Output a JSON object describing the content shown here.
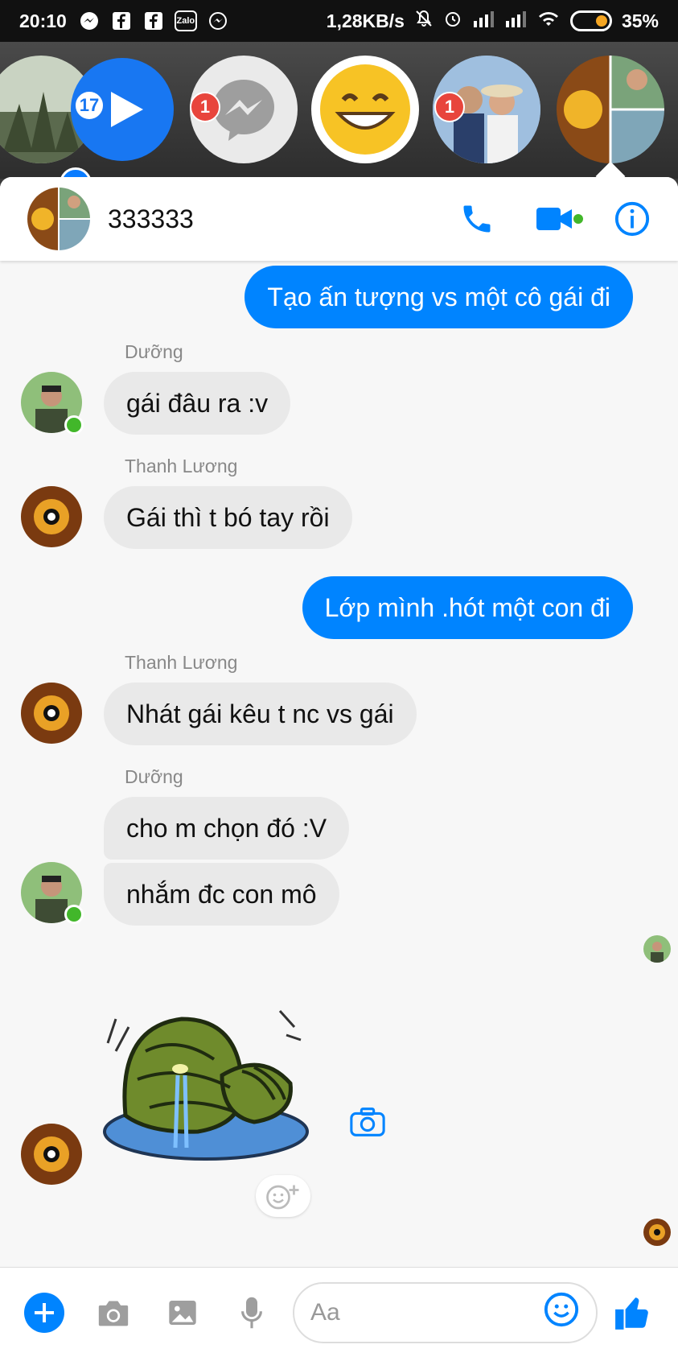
{
  "status_bar": {
    "time": "20:10",
    "icons": [
      "messenger-icon",
      "facebook-icon",
      "facebook-icon",
      "zalo-icon",
      "messenger-icon"
    ],
    "zalo_label": "Zalo",
    "net_speed": "1,28KB/s",
    "battery": "35%"
  },
  "chat_heads": {
    "items": [
      {
        "name": "photo-head"
      },
      {
        "name": "video-head",
        "badge": "17"
      },
      {
        "name": "messenger-head",
        "badge": "1"
      },
      {
        "name": "emoji-head"
      },
      {
        "name": "couple-head",
        "badge": "1"
      },
      {
        "name": "group-head"
      }
    ],
    "zalo_badge": "Zalo"
  },
  "chat": {
    "title": "333333",
    "colors": {
      "accent": "#0084ff",
      "online": "#42b72a"
    },
    "messages": [
      {
        "from": "me",
        "text": "Tạo ấn tượng vs một cô gái đi"
      },
      {
        "sender": "Dưỡng",
        "text": "gái đâu ra :v"
      },
      {
        "sender": "Thanh Lương",
        "text": "Gái thì t bó tay rồi"
      },
      {
        "from": "me",
        "text": "Lớp mình .hót một con đi"
      },
      {
        "sender": "Thanh Lương",
        "text": "Nhát gái kêu t nc vs gái"
      },
      {
        "sender": "Dưỡng",
        "text": "cho m chọn đó :V"
      },
      {
        "sender": "Dưỡng",
        "text": "nhắm đc con mô"
      }
    ]
  },
  "composer": {
    "placeholder": "Aa"
  }
}
